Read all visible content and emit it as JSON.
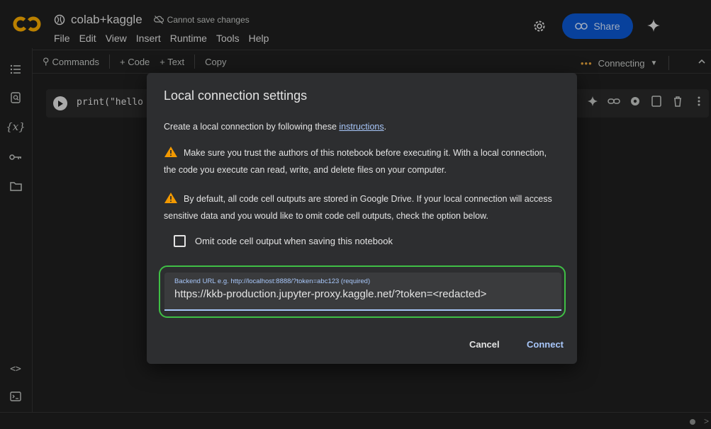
{
  "header": {
    "notebook_title": "colab+kaggle",
    "save_status": "Cannot save changes",
    "menu": [
      "File",
      "Edit",
      "View",
      "Insert",
      "Runtime",
      "Tools",
      "Help"
    ],
    "share_label": "Share"
  },
  "toolbar": {
    "commands_label": "Commands",
    "add_code_label": "+ Code",
    "add_text_label": "+ Text",
    "copy_label": "Copy",
    "connection_status": "Connecting"
  },
  "cell": {
    "code": "print(\"hello"
  },
  "dialog": {
    "title": "Local connection settings",
    "intro_text": "Create a local connection by following these",
    "intro_link": "instructions",
    "intro_end": ".",
    "warning_1": "Make sure you trust the authors of this notebook before executing it. With a local connection, the code you execute can read, write, and delete files on your computer.",
    "warning_2": "By default, all code cell outputs are stored in Google Drive. If your local connection will access sensitive data and you would like to omit code cell outputs, check the option below.",
    "checkbox_label": "Omit code cell output when saving this notebook",
    "url_label": "Backend URL e.g. http://localhost:8888/?token=abc123 (required)",
    "url_value": "https://kkb-production.jupyter-proxy.kaggle.net/?token=<redacted>",
    "cancel_label": "Cancel",
    "connect_label": "Connect"
  },
  "colors": {
    "accent": "#a8c7fa",
    "share_bg": "#0b57d0",
    "warning": "#f29900",
    "highlight_border": "#3fbf45",
    "logo": "#f9ab00"
  }
}
